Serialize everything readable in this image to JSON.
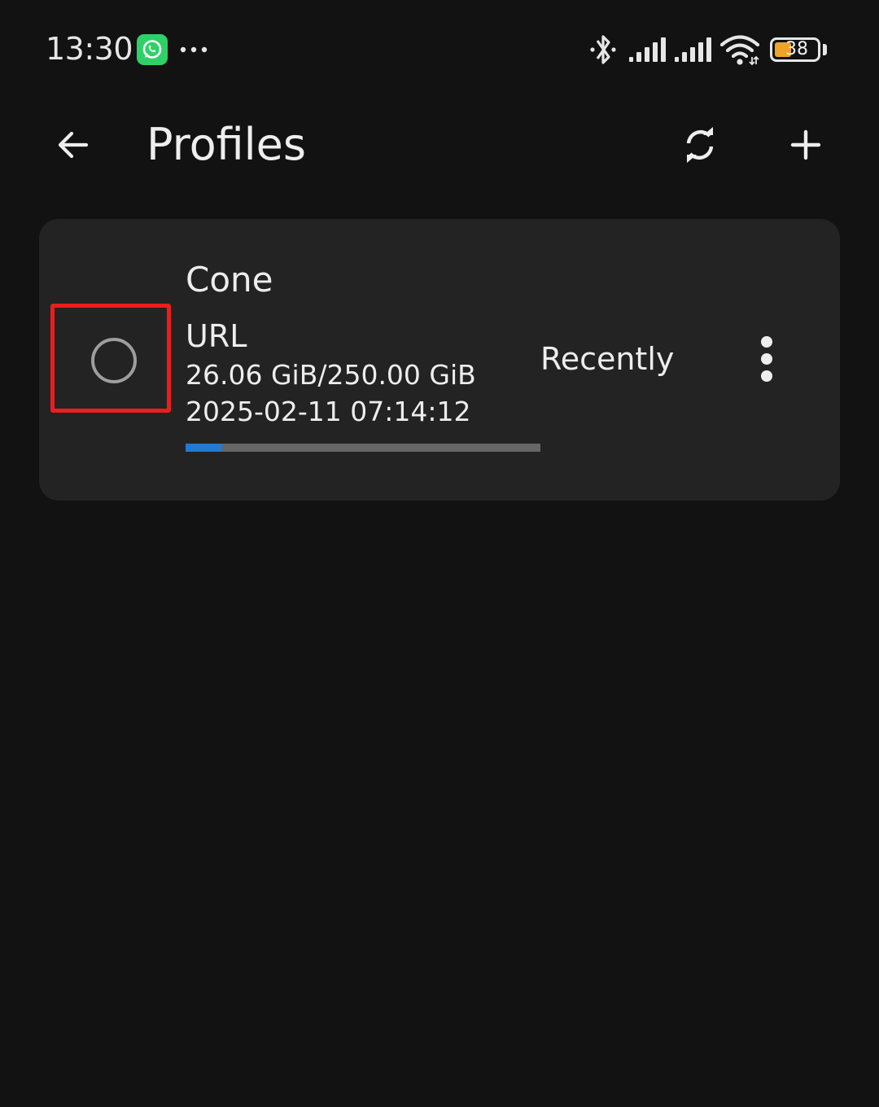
{
  "status_bar": {
    "time": "13:30",
    "battery_level": "38",
    "icons": [
      "whatsapp-icon",
      "more-dots-icon",
      "bluetooth-icon",
      "signal-icon",
      "signal-icon",
      "wifi-icon",
      "battery-icon"
    ],
    "battery_color": "#f0a32a"
  },
  "app_bar": {
    "title": "Profiles",
    "back_icon": "arrow-left-icon",
    "refresh_icon": "refresh-icon",
    "add_icon": "plus-icon"
  },
  "profiles": [
    {
      "name": "Cone",
      "type": "URL",
      "usage": "26.06 GiB/250.00 GiB",
      "expire": "2025-02-11 07:14:12",
      "updated": "Recently",
      "usage_fraction": 0.1042,
      "selected": false
    }
  ],
  "colors": {
    "background": "#121212",
    "card": "#232323",
    "accent": "#1f7ad4",
    "highlight": "#ee1c1c",
    "whatsapp": "#2fd067"
  }
}
